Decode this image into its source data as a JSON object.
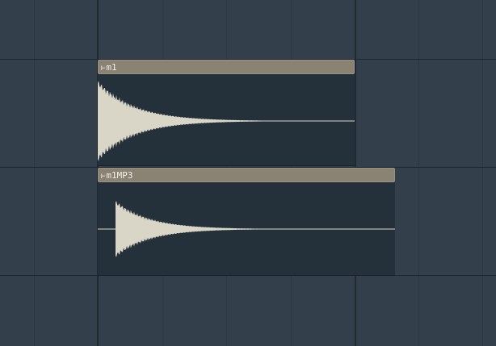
{
  "playlist": {
    "clips": [
      {
        "name": "m1",
        "arrow_glyph": "⊢",
        "wave_color": "#d9d6c7",
        "header_color": "#8a8272"
      },
      {
        "name": "m1MP3",
        "arrow_glyph": "⊢",
        "wave_color": "#d9d6c7",
        "header_color": "#8a8272"
      }
    ]
  },
  "colors": {
    "background": "#33404b",
    "clip_body": "#25313a",
    "grid_line": "#2b3741",
    "bar_line": "#1f2931"
  }
}
